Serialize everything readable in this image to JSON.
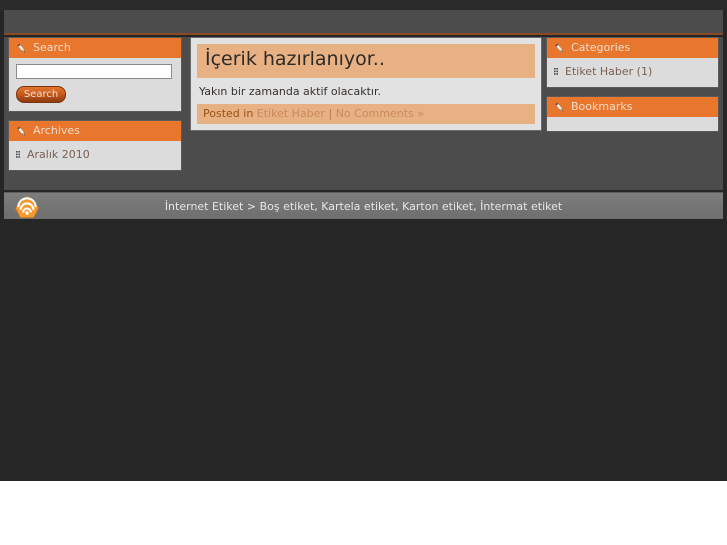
{
  "theme": {
    "accent_orange": "#e8762d",
    "panel_gray": "#dcdcdc",
    "page_dark": "#262626",
    "header_gray": "#4c4c4c",
    "title_peach": "#e8b183",
    "footer_gray": "#757575"
  },
  "header": {
    "title": ""
  },
  "sidebar_left": {
    "widgets": [
      {
        "title": "Search",
        "icon": "pencil-icon",
        "search": {
          "value": "",
          "placeholder": "",
          "submit_label": "Search"
        }
      },
      {
        "title": "Archives",
        "icon": "pencil-icon",
        "items": [
          {
            "label": "Aralık 2010",
            "bullet": "grid-bullet-icon"
          }
        ]
      }
    ]
  },
  "main": {
    "post": {
      "title": "İçerik hazırlanıyor..",
      "excerpt": "Yakın bir zamanda aktif olacaktır.",
      "meta": {
        "posted_in_label": "Posted in",
        "category": "Etiket Haber",
        "separator": "|",
        "comments": "No Comments »"
      }
    }
  },
  "sidebar_right": {
    "widgets": [
      {
        "title": "Categories",
        "icon": "pencil-icon",
        "items": [
          {
            "label": "Etiket Haber (1)",
            "bullet": "grid-bullet-icon"
          }
        ]
      },
      {
        "title": "Bookmarks",
        "icon": "pencil-icon",
        "items": []
      }
    ]
  },
  "footer": {
    "logo_icon": "rss-feed-icon",
    "breadcrumb": "İnternet Etiket > Boş etiket, Kartela etiket, Karton etiket, İntermat etiket"
  }
}
